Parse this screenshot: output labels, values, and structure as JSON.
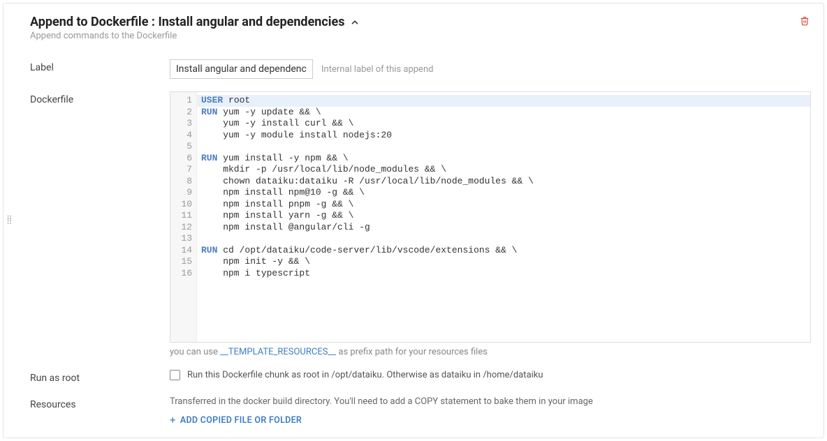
{
  "header": {
    "title_prefix": "Append to Dockerfile : ",
    "title_value": "Install angular and dependencies",
    "subtitle": "Append commands to the Dockerfile"
  },
  "fields": {
    "label": {
      "label": "Label",
      "value": "Install angular and dependencies",
      "hint": "Internal label of this append"
    },
    "dockerfile": {
      "label": "Dockerfile",
      "lines": [
        {
          "n": "1",
          "raw": "USER root",
          "kw": "USER",
          "rest": " root",
          "active": true
        },
        {
          "n": "2",
          "raw": "RUN yum -y update && \\",
          "kw": "RUN",
          "rest": " yum -y update && \\"
        },
        {
          "n": "3",
          "raw": "    yum -y install curl && \\"
        },
        {
          "n": "4",
          "raw": "    yum -y module install nodejs:20"
        },
        {
          "n": "5",
          "raw": ""
        },
        {
          "n": "6",
          "raw": "RUN yum install -y npm && \\",
          "kw": "RUN",
          "rest": " yum install -y npm && \\"
        },
        {
          "n": "7",
          "raw": "    mkdir -p /usr/local/lib/node_modules && \\"
        },
        {
          "n": "8",
          "raw": "    chown dataiku:dataiku -R /usr/local/lib/node_modules && \\"
        },
        {
          "n": "9",
          "raw": "    npm install npm@10 -g && \\"
        },
        {
          "n": "10",
          "raw": "    npm install pnpm -g && \\"
        },
        {
          "n": "11",
          "raw": "    npm install yarn -g && \\"
        },
        {
          "n": "12",
          "raw": "    npm install @angular/cli -g"
        },
        {
          "n": "13",
          "raw": ""
        },
        {
          "n": "14",
          "raw": "RUN cd /opt/dataiku/code-server/lib/vscode/extensions && \\",
          "kw": "RUN",
          "rest": " cd /opt/dataiku/code-server/lib/vscode/extensions && \\"
        },
        {
          "n": "15",
          "raw": "    npm init -y && \\"
        },
        {
          "n": "16",
          "raw": "    npm i typescript"
        }
      ],
      "helper_pre": "you can use ",
      "helper_token": "__TEMPLATE_RESOURCES__",
      "helper_post": " as prefix path for your resources files"
    },
    "runAsRoot": {
      "label": "Run as root",
      "checkbox_label": "Run this Dockerfile chunk as root in /opt/dataiku. Otherwise as dataiku in /home/dataiku",
      "checked": false
    },
    "resources": {
      "label": "Resources",
      "text": "Transferred in the docker build directory. You'll need to add a COPY statement to bake them in your image",
      "add_label": "ADD COPIED FILE OR FOLDER"
    }
  }
}
